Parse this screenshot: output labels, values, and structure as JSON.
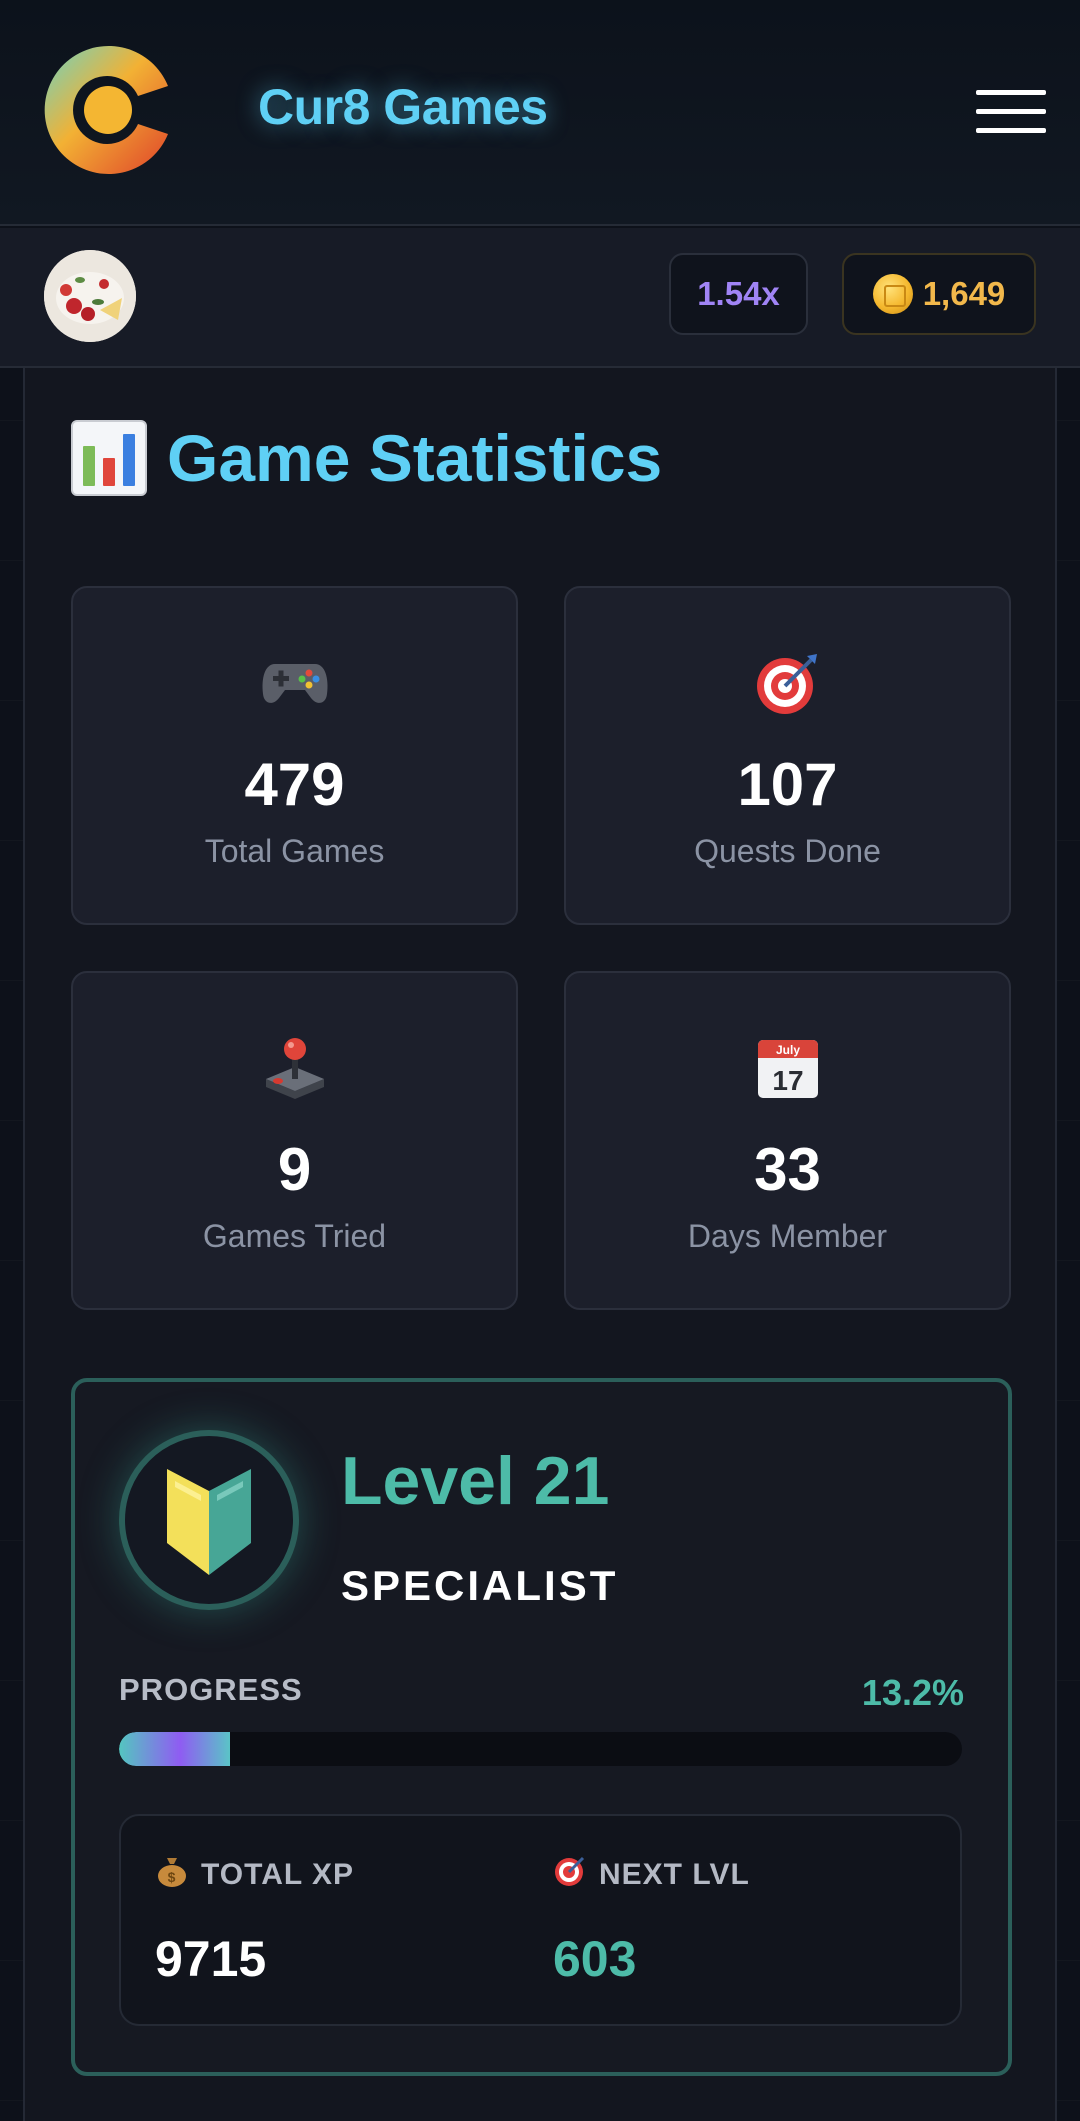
{
  "header": {
    "brand": "Cur8 Games",
    "logo_icon": "cur8-logo",
    "menu_icon": "hamburger-menu-icon"
  },
  "userbar": {
    "multiplier": "1.54x",
    "coins": "1,649",
    "coin_icon": "coin-icon",
    "colors": {
      "multiplier": "#a084f5",
      "coins": "#f2b84b"
    }
  },
  "stats": {
    "title": "Game Statistics",
    "title_icon": "bar-chart-icon",
    "cards": [
      {
        "icon": "gamepad-icon",
        "value": "479",
        "label": "Total Games"
      },
      {
        "icon": "target-icon",
        "value": "107",
        "label": "Quests Done"
      },
      {
        "icon": "joystick-icon",
        "value": "9",
        "label": "Games Tried"
      },
      {
        "icon": "calendar-icon",
        "value": "33",
        "label": "Days Member",
        "calendar_month": "July",
        "calendar_day": "17"
      }
    ]
  },
  "level": {
    "title": "Level 21",
    "rank": "SPECIALIST",
    "badge_icon": "beginner-shield-icon",
    "progress_label": "PROGRESS",
    "progress_pct": "13.2%",
    "progress_value": 0.132,
    "xp_total_label": "TOTAL XP",
    "xp_total_icon": "money-bag-icon",
    "xp_total": "9715",
    "next_label": "NEXT LVL",
    "next_icon": "target-icon",
    "next_value": "603",
    "colors": {
      "accent": "#4dbba8",
      "border": "#2b5f5a"
    }
  }
}
